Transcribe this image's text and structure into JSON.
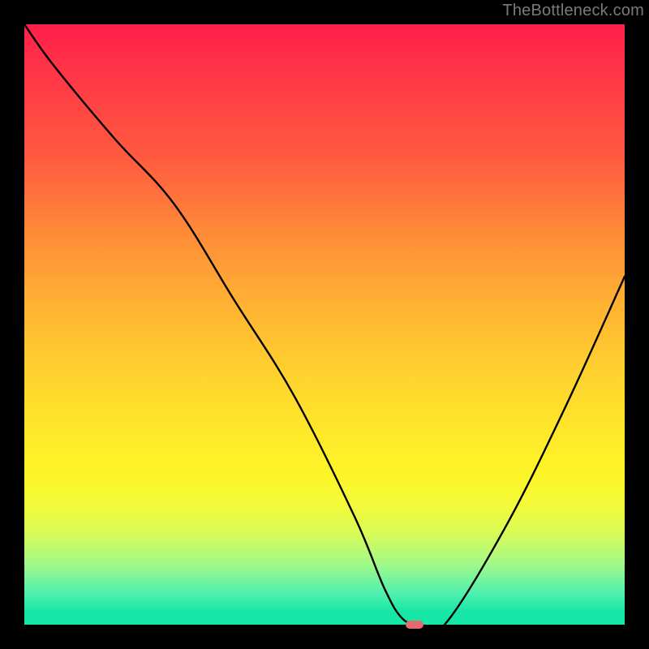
{
  "watermark": "TheBottleneck.com",
  "chart_data": {
    "type": "line",
    "title": "",
    "xlabel": "",
    "ylabel": "",
    "xlim": [
      0,
      100
    ],
    "ylim": [
      0,
      100
    ],
    "grid": false,
    "series": [
      {
        "name": "bottleneck-curve",
        "x": [
          0,
          5,
          15,
          25,
          35,
          45,
          55,
          60,
          63,
          66,
          70,
          80,
          90,
          100
        ],
        "y": [
          100,
          93,
          81,
          70,
          54,
          38,
          18,
          6,
          1,
          0,
          0,
          16,
          36,
          58
        ]
      }
    ],
    "marker": {
      "x": 65,
      "y": 0,
      "color": "#e46a6f"
    },
    "background_gradient": {
      "top": "#ff1f4a",
      "mid": "#ffe82a",
      "bottom": "#16e6a6"
    }
  }
}
